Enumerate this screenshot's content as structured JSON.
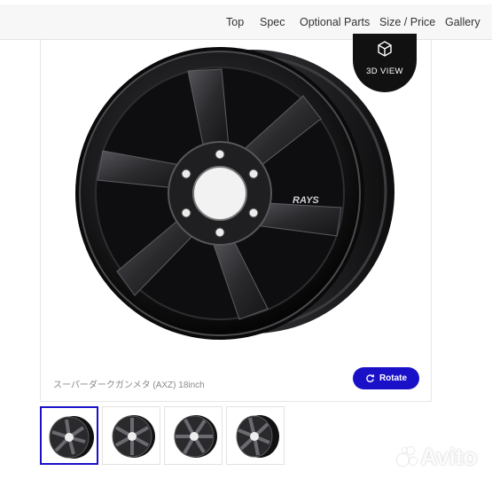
{
  "nav": {
    "items": [
      {
        "label": "Top"
      },
      {
        "label": "Spec"
      },
      {
        "label": "Optional Parts"
      },
      {
        "label": "Size / Price"
      },
      {
        "label": "Gallery"
      }
    ]
  },
  "viewer": {
    "view3d_label": "3D VIEW",
    "caption": "スーパーダークガンメタ (AXZ) 18inch",
    "rotate_label": "Rotate",
    "brand_mark": "RAYS",
    "thumbnails_count": 4,
    "active_thumbnail": 1
  },
  "watermark": {
    "text": "Avito"
  },
  "colors": {
    "accent": "#1a10c8",
    "view3d_bg": "#111111",
    "wheel": "#1c1c1e"
  }
}
